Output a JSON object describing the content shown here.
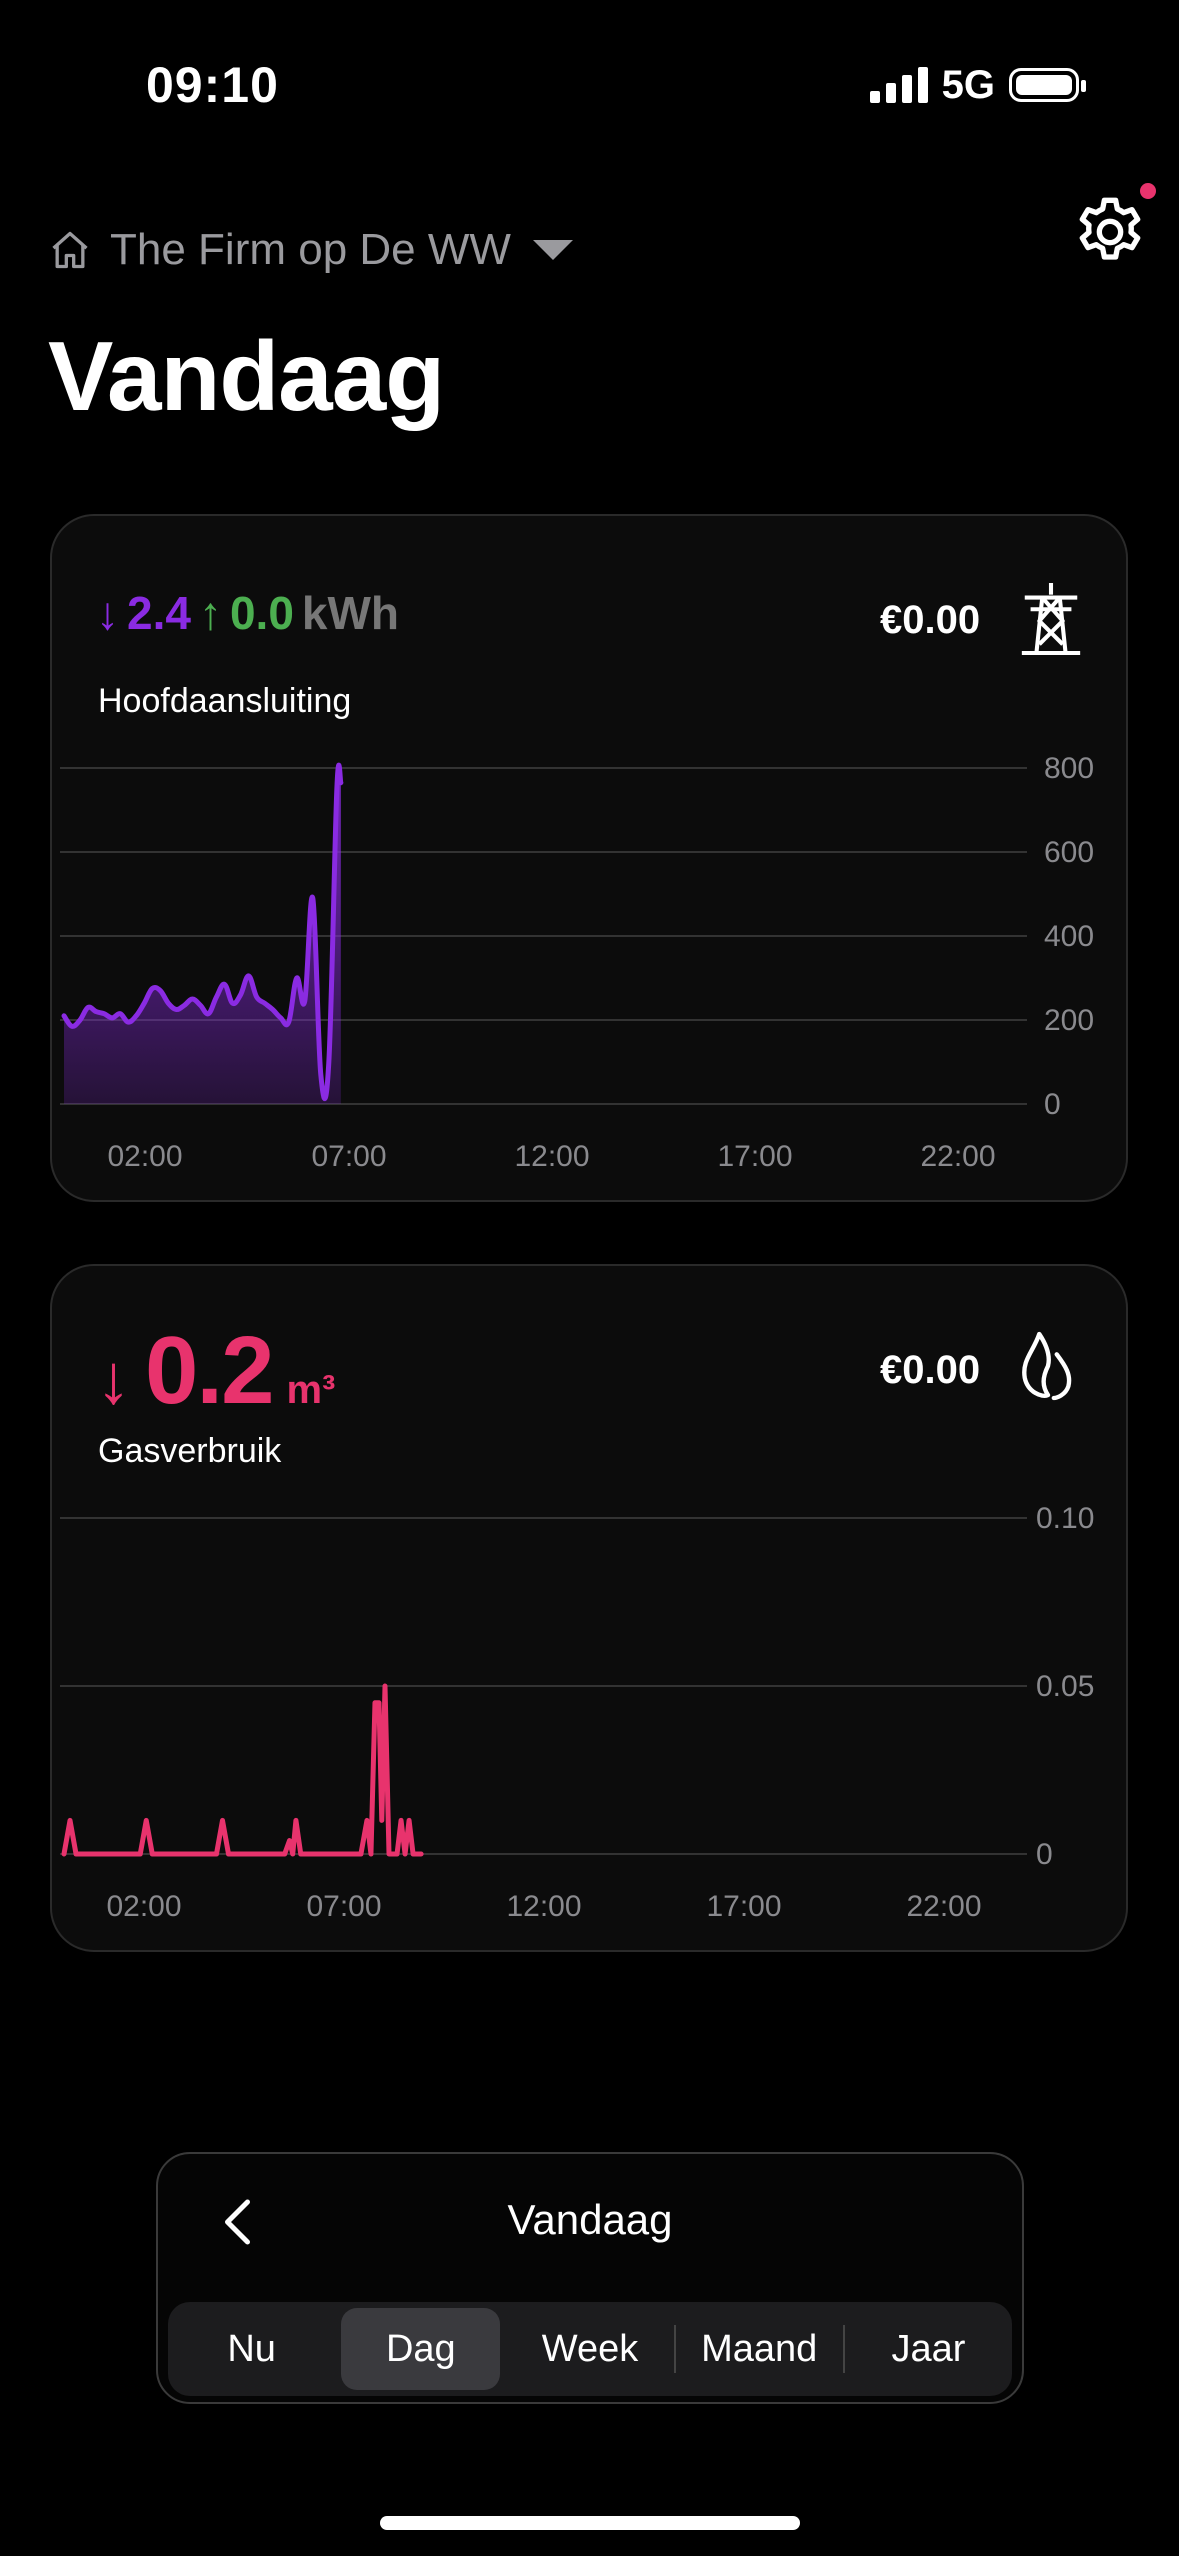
{
  "status": {
    "time": "09:10",
    "network": "5G"
  },
  "header": {
    "location": "The Firm op De WW",
    "title": "Vandaag"
  },
  "electricity": {
    "import_value": "2.4",
    "export_value": "0.0",
    "unit": "kWh",
    "label": "Hoofdaansluiting",
    "price": "€0.00",
    "icon": "power-pylon-icon"
  },
  "gas": {
    "value": "0.2",
    "unit": "m³",
    "label": "Gasverbruik",
    "price": "€0.00",
    "icon": "flame-icon"
  },
  "range_control": {
    "title": "Vandaag",
    "tabs": [
      "Nu",
      "Dag",
      "Week",
      "Maand",
      "Jaar"
    ],
    "active_tab": "Dag"
  },
  "colors": {
    "electric": "#8a2be2",
    "export": "#4caf50",
    "gas": "#e8336d"
  },
  "chart_data": [
    {
      "type": "area",
      "series": [
        {
          "values": [
            [
              0,
              210
            ],
            [
              0.2,
              185
            ],
            [
              0.4,
              200
            ],
            [
              0.6,
              230
            ],
            [
              0.8,
              220
            ],
            [
              1.0,
              215
            ],
            [
              1.2,
              205
            ],
            [
              1.4,
              215
            ],
            [
              1.6,
              195
            ],
            [
              1.8,
              210
            ],
            [
              2.0,
              240
            ],
            [
              2.2,
              275
            ],
            [
              2.4,
              270
            ],
            [
              2.6,
              240
            ],
            [
              2.8,
              225
            ],
            [
              3.0,
              235
            ],
            [
              3.2,
              250
            ],
            [
              3.4,
              235
            ],
            [
              3.6,
              215
            ],
            [
              3.8,
              255
            ],
            [
              4.0,
              285
            ],
            [
              4.2,
              240
            ],
            [
              4.4,
              260
            ],
            [
              4.6,
              305
            ],
            [
              4.8,
              255
            ],
            [
              5.0,
              240
            ],
            [
              5.2,
              225
            ],
            [
              5.4,
              205
            ],
            [
              5.6,
              195
            ],
            [
              5.8,
              300
            ],
            [
              6.0,
              245
            ],
            [
              6.2,
              490
            ],
            [
              6.4,
              70
            ],
            [
              6.6,
              100
            ],
            [
              6.8,
              750
            ],
            [
              6.9,
              765
            ]
          ]
        }
      ],
      "xticks": [
        "02:00",
        "07:00",
        "12:00",
        "17:00",
        "22:00"
      ],
      "yticks": [
        0,
        200,
        400,
        600,
        800
      ],
      "ylim": [
        0,
        800
      ],
      "xlim": [
        0,
        24
      ],
      "grid": true
    },
    {
      "type": "line",
      "series": [
        {
          "values": [
            [
              0,
              0
            ],
            [
              0.15,
              0.01
            ],
            [
              0.3,
              0
            ],
            [
              1.9,
              0
            ],
            [
              2.05,
              0.01
            ],
            [
              2.2,
              0
            ],
            [
              3.8,
              0
            ],
            [
              3.95,
              0.01
            ],
            [
              4.1,
              0
            ],
            [
              5.5,
              0
            ],
            [
              5.62,
              0.004
            ],
            [
              5.7,
              0
            ],
            [
              5.78,
              0.01
            ],
            [
              5.9,
              0
            ],
            [
              7.4,
              0
            ],
            [
              7.55,
              0.01
            ],
            [
              7.65,
              0
            ],
            [
              7.75,
              0.045
            ],
            [
              7.85,
              0.045
            ],
            [
              7.92,
              0.01
            ],
            [
              8.0,
              0.05
            ],
            [
              8.1,
              0
            ],
            [
              8.3,
              0
            ],
            [
              8.4,
              0.01
            ],
            [
              8.5,
              0
            ],
            [
              8.6,
              0.01
            ],
            [
              8.7,
              0
            ],
            [
              8.9,
              0
            ]
          ]
        }
      ],
      "xticks": [
        "02:00",
        "07:00",
        "12:00",
        "17:00",
        "22:00"
      ],
      "yticks": [
        "0",
        "0.05",
        "0.10"
      ],
      "ylim": [
        0,
        0.1
      ],
      "xlim": [
        0,
        24
      ],
      "grid": true
    }
  ]
}
